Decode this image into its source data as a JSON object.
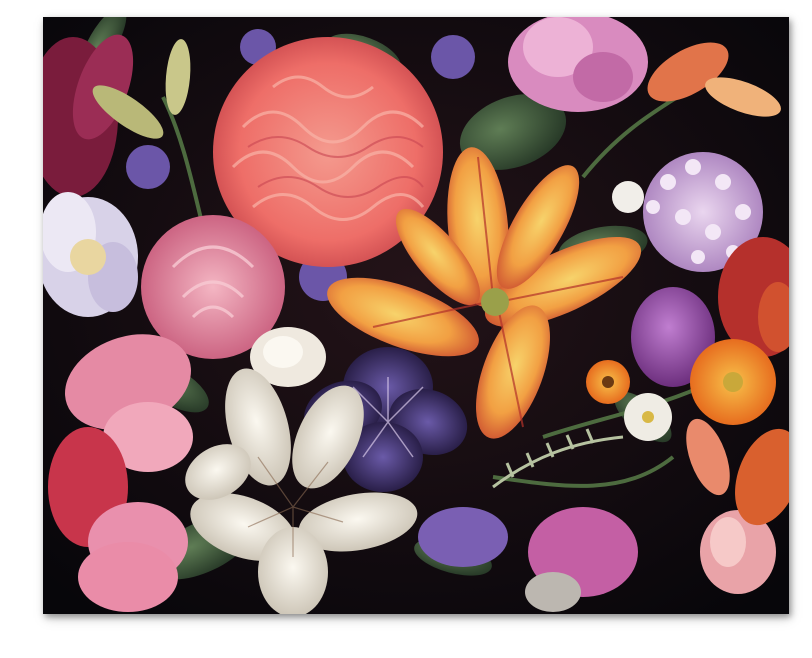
{
  "colors": {
    "background": "#ffffff",
    "canvas_dark": "#0e0a0d",
    "carnation_coral": "#f07a72",
    "lily_orange": "#f2a043",
    "rose_pink": "#e98ba0",
    "iris_indigo": "#3b3170",
    "white_lily": "#f1ece2",
    "lilac_violet": "#c9a8d6",
    "leaf_green": "#3f5a3a",
    "gerbera_orange": "#f07a1e"
  },
  "icons": [
    "flower-painting"
  ]
}
